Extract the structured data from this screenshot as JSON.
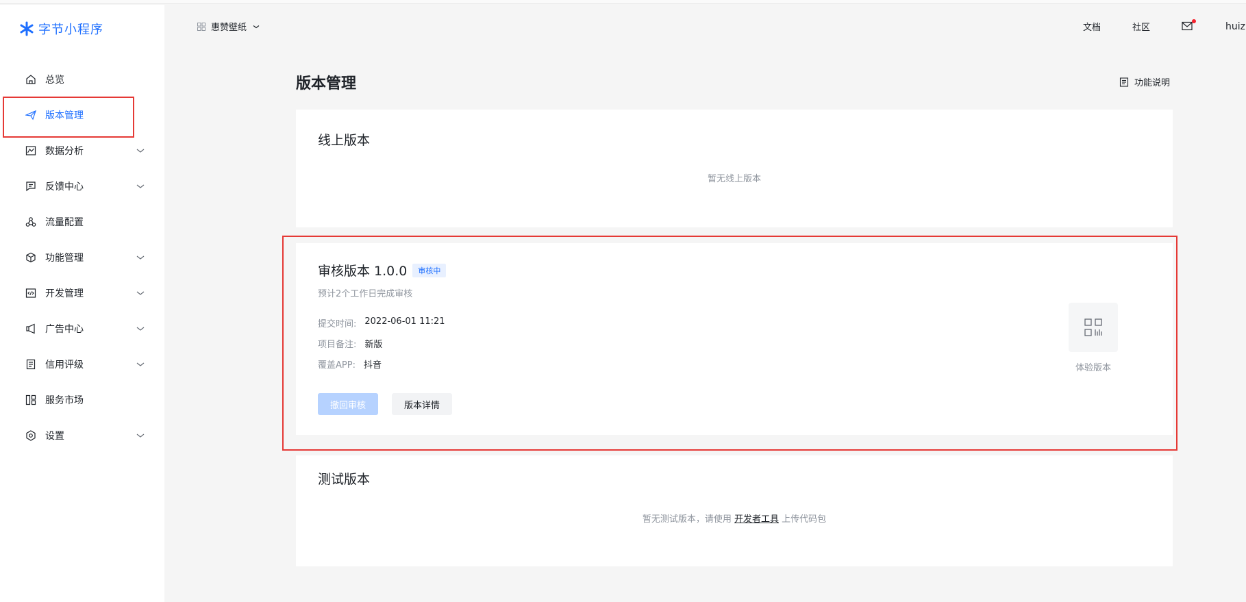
{
  "brand": {
    "name": "字节小程序"
  },
  "app_switch": {
    "name": "惠赞壁纸"
  },
  "top_links": {
    "docs": "文档",
    "community": "社区",
    "user": "huiz"
  },
  "nav": {
    "items": [
      {
        "label": "总览"
      },
      {
        "label": "版本管理",
        "active": true
      },
      {
        "label": "数据分析"
      },
      {
        "label": "反馈中心"
      },
      {
        "label": "流量配置"
      },
      {
        "label": "功能管理"
      },
      {
        "label": "开发管理"
      },
      {
        "label": "广告中心"
      },
      {
        "label": "信用评级"
      },
      {
        "label": "服务市场"
      },
      {
        "label": "设置"
      }
    ]
  },
  "page": {
    "title": "版本管理",
    "help": "功能说明"
  },
  "online": {
    "title": "线上版本",
    "empty": "暂无线上版本"
  },
  "review": {
    "title": "审核版本 1.0.0",
    "status": "审核中",
    "tip": "预计2个工作日完成审核",
    "submit_label": "提交时间:",
    "submit_value": "2022-06-01 11:21",
    "remark_label": "项目备注:",
    "remark_value": "新版",
    "app_label": "覆盖APP:",
    "app_value": "抖音",
    "withdraw_btn": "撤回审核",
    "detail_btn": "版本详情",
    "qr_label": "体验版本"
  },
  "test": {
    "title": "测试版本",
    "empty_prefix": "暂无测试版本，请使用",
    "empty_link": "开发者工具",
    "empty_suffix": "上传代码包"
  },
  "colors": {
    "accent": "#1e6fff",
    "highlight": "#e53935",
    "muted": "#8f959e"
  }
}
